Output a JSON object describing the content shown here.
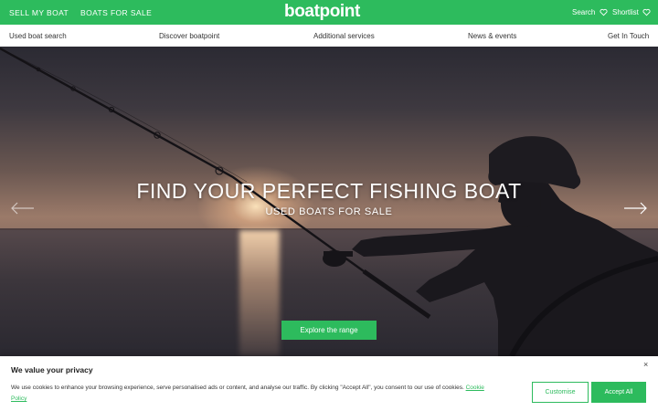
{
  "topbar": {
    "sell_link": "SELL MY BOAT",
    "boats_link": "BOATS FOR SALE",
    "logo": "boatpoint",
    "search_label": "Search",
    "shortlist_label": "Shortlist",
    "search_icon": "heart-icon",
    "shortlist_icon": "heart-icon"
  },
  "nav": {
    "items": [
      "Used boat search",
      "Discover boatpoint",
      "Additional services",
      "News & events",
      "Get In Touch"
    ]
  },
  "hero": {
    "title": "FIND YOUR PERFECT FISHING BOAT",
    "subtitle": "USED BOATS FOR SALE",
    "cta": "Explore the range",
    "prev_icon": "arrow-left-icon",
    "next_icon": "arrow-right-icon",
    "slide_count": 2,
    "active_slide": 1
  },
  "cookie": {
    "title": "We value your privacy",
    "text": "We use cookies to enhance your browsing experience, serve personalised ads or content, and analyse our traffic. By clicking \"Accept All\", you consent to our use of cookies.",
    "policy_link": "Cookie Policy",
    "customise": "Customise",
    "accept": "Accept All",
    "close_icon": "close-icon"
  },
  "colors": {
    "brand": "#2dbb5d"
  }
}
